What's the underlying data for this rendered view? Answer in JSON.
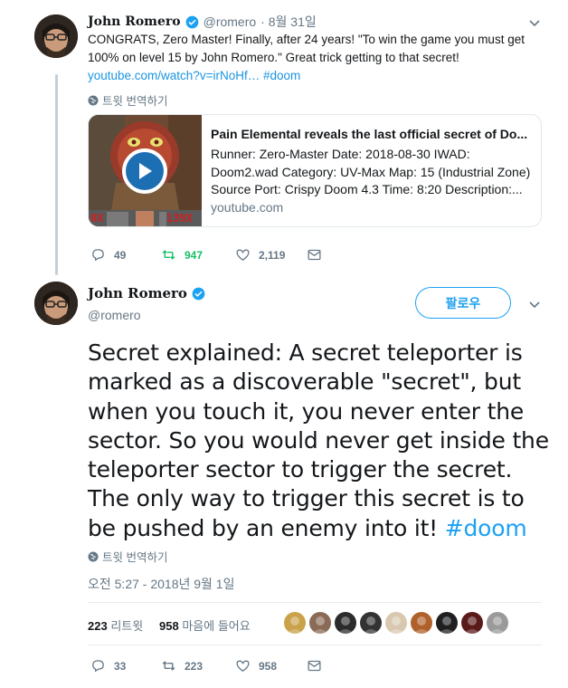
{
  "tweet1": {
    "name": "John Romero",
    "handle": "@romero",
    "date": "· 8월 31일",
    "text_before": "CONGRATS, Zero Master! Finally, after 24 years! \"To win the game you must get 100% on level 15 by John Romero.\" Great trick getting to that secret! ",
    "link": "youtube.com/watch?v=irNoHf…",
    "hashtag": "#doom",
    "translate": "트윗 번역하기",
    "card": {
      "title": "Pain Elemental reveals the last official secret of Do...",
      "description": "Runner: Zero-Master Date: 2018-08-30 IWAD: Doom2.wad Category: UV-Max Map: 15 (Industrial Zone) Source Port: Crispy Doom 4.3 Time: 8:20 Description:...",
      "domain": "youtube.com",
      "hud_left": "0X",
      "hud_right": "139X"
    },
    "actions": {
      "replies": "49",
      "retweets": "947",
      "likes": "2,119"
    }
  },
  "tweet2": {
    "name": "John Romero",
    "handle": "@romero",
    "follow_label": "팔로우",
    "text_before": "Secret explained: A secret teleporter is marked as a discoverable \"secret\", but when you touch it, you never enter the sector. So you would never get inside the teleporter sector to trigger the secret. The only way to trigger this secret is to be pushed by an enemy into it! ",
    "hashtag": "#doom",
    "translate": "트윗 번역하기",
    "timestamp": "오전 5:27 - 2018년 9월 1일",
    "stats": {
      "retweet_count": "223",
      "retweet_label": "리트윗",
      "like_count": "958",
      "like_label": "마음에 들어요"
    },
    "likers": [
      "#c9a24a",
      "#8a6b55",
      "#2b2b2b",
      "#333333",
      "#d8c8b0",
      "#b0602a",
      "#1f1f1f",
      "#5a1a1a",
      "#9a9a9a"
    ],
    "actions": {
      "replies": "33",
      "retweets": "223",
      "likes": "958"
    }
  },
  "colors": {
    "accent": "#1da1f2",
    "retweet_active": "#17bf63",
    "muted": "#657786"
  }
}
